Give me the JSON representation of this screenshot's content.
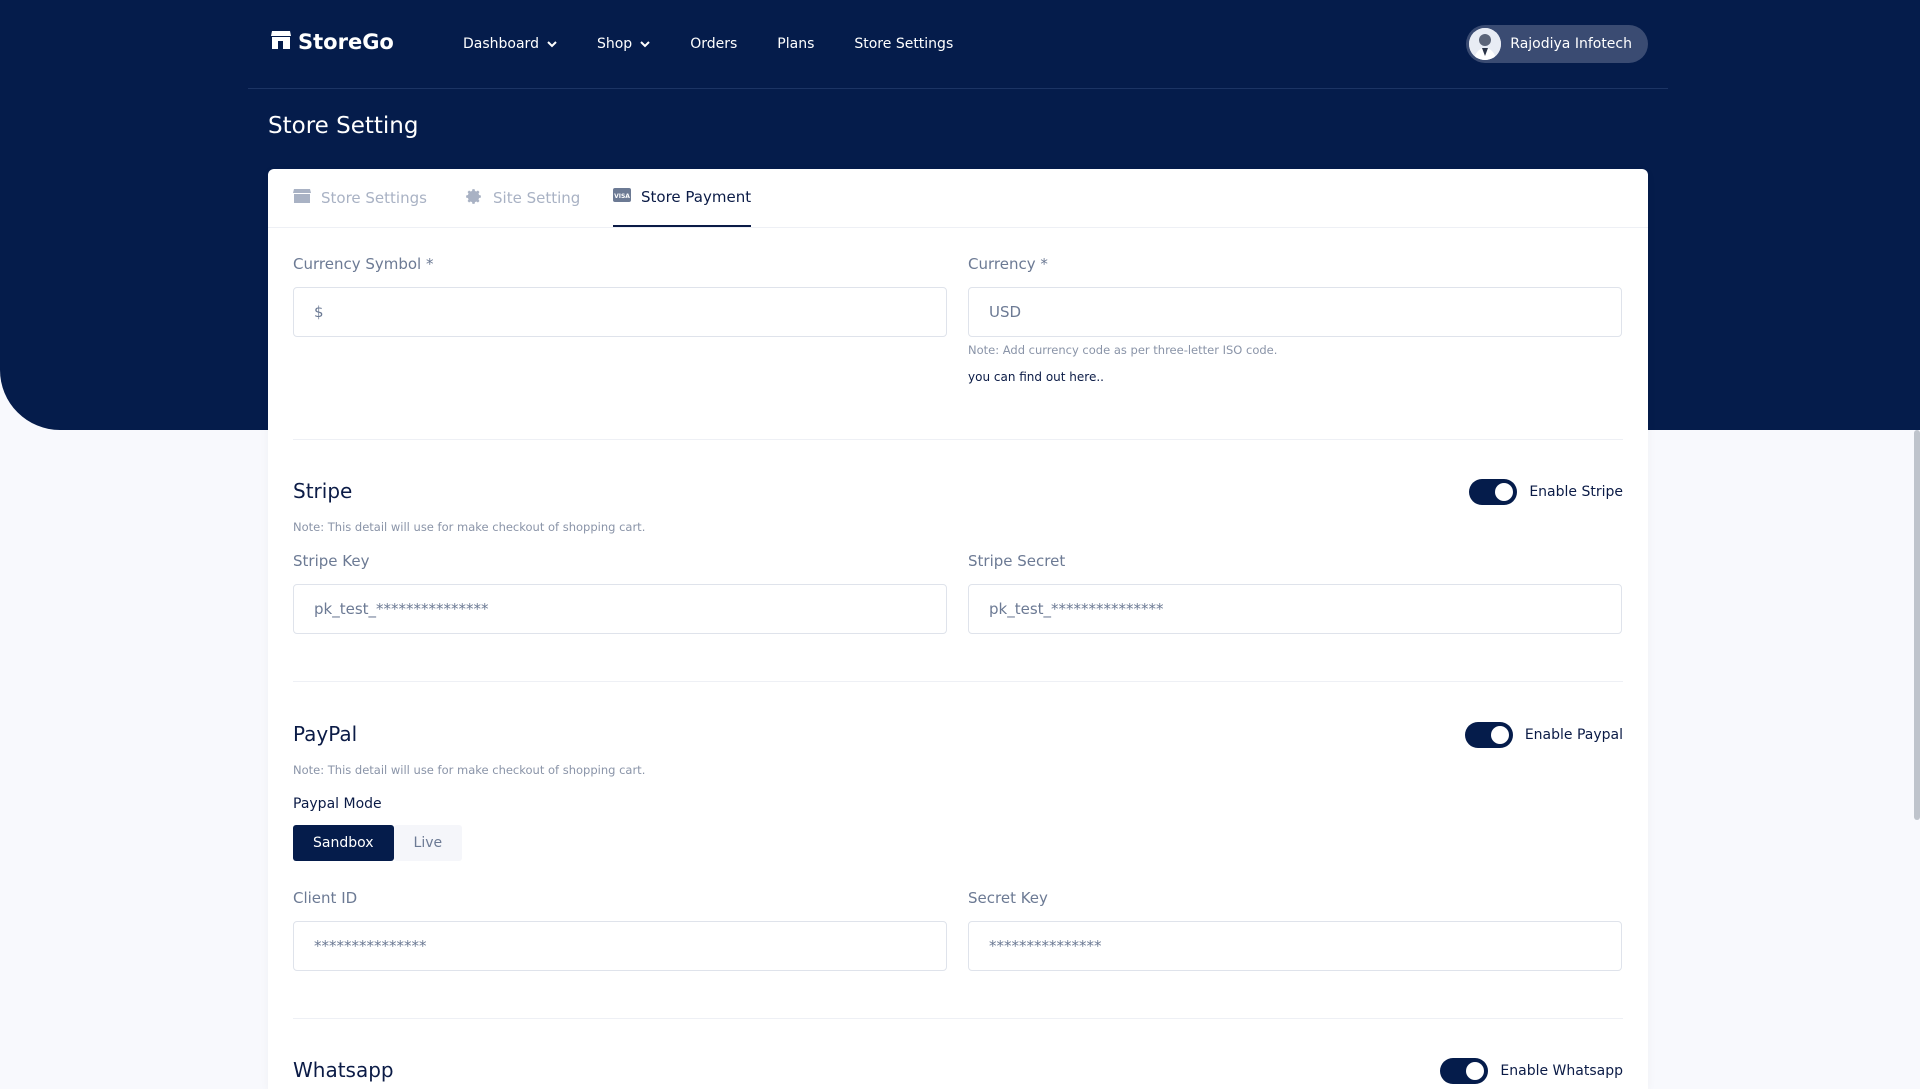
{
  "app": {
    "brand": "StoreGo"
  },
  "nav": {
    "items": [
      {
        "label": "Dashboard",
        "has_dropdown": true
      },
      {
        "label": "Shop",
        "has_dropdown": true
      },
      {
        "label": "Orders",
        "has_dropdown": false
      },
      {
        "label": "Plans",
        "has_dropdown": false
      },
      {
        "label": "Store Settings",
        "has_dropdown": false
      }
    ],
    "user_name": "Rajodiya Infotech"
  },
  "page": {
    "title": "Store Setting"
  },
  "tabs": [
    {
      "label": "Store Settings",
      "icon": "store-icon",
      "active": false
    },
    {
      "label": "Site Setting",
      "icon": "gear-icon",
      "active": false
    },
    {
      "label": "Store Payment",
      "icon": "visa-card-icon",
      "active": true
    }
  ],
  "currency": {
    "symbol_label": "Currency Symbol *",
    "symbol_value": "$",
    "code_label": "Currency *",
    "code_value": "USD",
    "note": "Note: Add currency code as per three-letter ISO code.",
    "link": "you can find out here.."
  },
  "stripe": {
    "title": "Stripe",
    "toggle_label": "Enable Stripe",
    "enabled": true,
    "note": "Note: This detail will use for make checkout of shopping cart.",
    "key_label": "Stripe Key",
    "key_value": "pk_test_***************",
    "secret_label": "Stripe Secret",
    "secret_value": "pk_test_***************"
  },
  "paypal": {
    "title": "PayPal",
    "toggle_label": "Enable Paypal",
    "enabled": true,
    "note": "Note: This detail will use for make checkout of shopping cart.",
    "mode_label": "Paypal Mode",
    "modes": [
      "Sandbox",
      "Live"
    ],
    "selected_mode": "Sandbox",
    "client_label": "Client ID",
    "client_value": "***************",
    "secret_label": "Secret Key",
    "secret_value": "***************"
  },
  "whatsapp": {
    "title": "Whatsapp",
    "toggle_label": "Enable Whatsapp",
    "enabled": true
  },
  "colors": {
    "primary": "#051c4b",
    "background": "#f8f9fd",
    "muted": "#6c7a94"
  }
}
